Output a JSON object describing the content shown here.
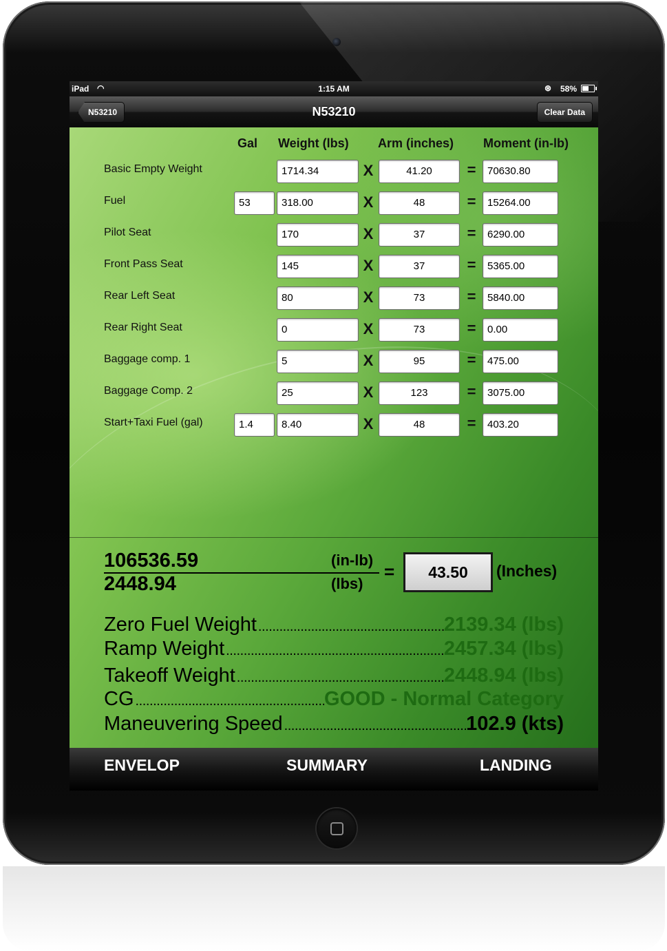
{
  "status": {
    "carrier": "iPad",
    "time": "1:15 AM",
    "battery": "58%"
  },
  "nav": {
    "back_label": "N53210",
    "title": "N53210",
    "clear_label": "Clear Data"
  },
  "columns": {
    "gal": "Gal",
    "weight": "Weight (lbs)",
    "arm": "Arm (inches)",
    "moment": "Moment (in-lb)"
  },
  "ops": {
    "times": "X",
    "equals": "="
  },
  "rows": [
    {
      "label": "Basic Empty Weight",
      "gal": "",
      "weight": "1714.34",
      "arm": "41.20",
      "moment": "70630.80"
    },
    {
      "label": "Fuel",
      "gal": "53",
      "weight": "318.00",
      "arm": "48",
      "moment": "15264.00"
    },
    {
      "label": "Pilot Seat",
      "gal": "",
      "weight": "170",
      "arm": "37",
      "moment": "6290.00"
    },
    {
      "label": "Front Pass Seat",
      "gal": "",
      "weight": "145",
      "arm": "37",
      "moment": "5365.00"
    },
    {
      "label": "Rear Left Seat",
      "gal": "",
      "weight": "80",
      "arm": "73",
      "moment": "5840.00"
    },
    {
      "label": "Rear Right Seat",
      "gal": "",
      "weight": "0",
      "arm": "73",
      "moment": "0.00"
    },
    {
      "label": "Baggage comp. 1",
      "gal": "",
      "weight": "5",
      "arm": "95",
      "moment": "475.00"
    },
    {
      "label": "Baggage Comp. 2",
      "gal": "",
      "weight": "25",
      "arm": "123",
      "moment": "3075.00"
    },
    {
      "label": "Start+Taxi Fuel (gal)",
      "gal": "1.4",
      "weight": "8.40",
      "arm": "48",
      "moment": "403.20"
    }
  ],
  "cg_calc": {
    "total_moment": "106536.59",
    "total_weight": "2448.94",
    "moment_unit": "(in-lb)",
    "weight_unit": "(lbs)",
    "equals": "=",
    "result": "43.50",
    "result_unit": "(Inches)"
  },
  "summary": [
    {
      "label": "Zero Fuel Weight",
      "value": "2139.34 (lbs)"
    },
    {
      "label": "Ramp Weight",
      "value": "2457.34 (lbs)"
    },
    {
      "label": "Takeoff Weight",
      "value": "2448.94 (lbs)"
    },
    {
      "label": "CG",
      "value": "GOOD - Normal Category"
    },
    {
      "label": "Maneuvering Speed",
      "value": "102.9 (kts)"
    }
  ],
  "tabs": {
    "envelop": "ENVELOP",
    "summary": "SUMMARY",
    "landing": "LANDING"
  },
  "colors": {
    "good_green": "#1e6b12",
    "background_green": "#5aa83a"
  }
}
